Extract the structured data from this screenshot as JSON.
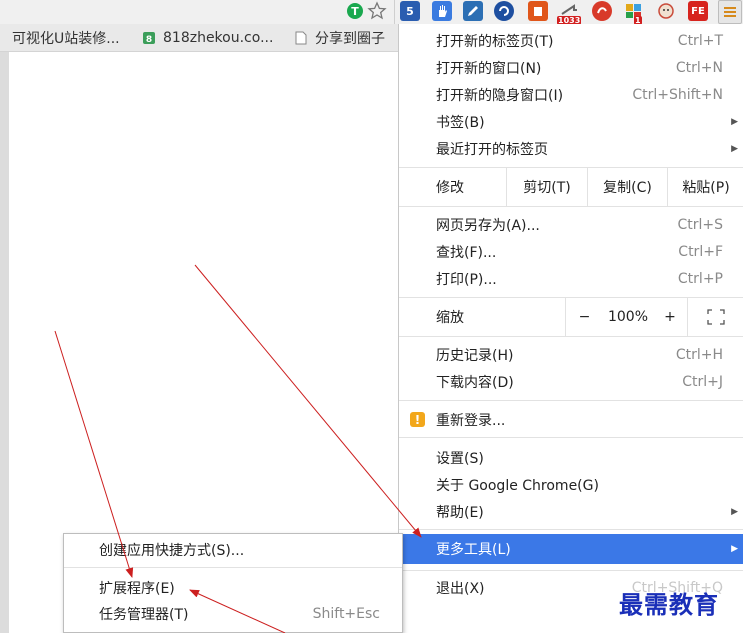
{
  "toolbar": {
    "extensions": [
      {
        "icon": "green-shield-extension-icon",
        "color": "#1aa84f",
        "text": ""
      },
      {
        "icon": "star-bookmark-icon",
        "color": "",
        "text": ""
      },
      {
        "icon": "extension-5-icon",
        "color": "#2a5db0",
        "text": "5"
      },
      {
        "icon": "hand-extension-icon",
        "color": "#3a7be0",
        "text": ""
      },
      {
        "icon": "pen-extension-icon",
        "color": "#2c6fb4",
        "text": ""
      },
      {
        "icon": "swirl-extension-icon",
        "color": "#1e4fa0",
        "text": ""
      },
      {
        "icon": "orange-box-extension-icon",
        "color": "#e0561a",
        "text": ""
      },
      {
        "icon": "arrow-extension-icon",
        "color": "#7a7a7a",
        "text": "",
        "badge": "1033"
      },
      {
        "icon": "red-circle-extension-icon",
        "color": "#d83a2a",
        "text": ""
      },
      {
        "icon": "puzzle-extension-icon",
        "color": "#3aa0e0",
        "text": "",
        "badge": "1"
      },
      {
        "icon": "mascot-extension-icon",
        "color": "#c94b3a",
        "text": ""
      },
      {
        "icon": "fe-extension-icon",
        "color": "#d7241e",
        "text": "FE"
      },
      {
        "icon": "chrome-menu-icon",
        "color": "#e0a340",
        "text": ""
      }
    ]
  },
  "bookmarks": [
    {
      "label": "可视化U站装修..."
    },
    {
      "label": "818zhekou.co..."
    },
    {
      "label": "分享到圈子"
    }
  ],
  "menu": {
    "new_tab": {
      "label": "打开新的标签页(T)",
      "shortcut": "Ctrl+T"
    },
    "new_window": {
      "label": "打开新的窗口(N)",
      "shortcut": "Ctrl+N"
    },
    "incognito": {
      "label": "打开新的隐身窗口(I)",
      "shortcut": "Ctrl+Shift+N"
    },
    "bookmarks": {
      "label": "书签(B)"
    },
    "recent_tabs": {
      "label": "最近打开的标签页"
    },
    "edit": {
      "label": "修改",
      "cut": "剪切(T)",
      "copy": "复制(C)",
      "paste": "粘贴(P)"
    },
    "save_page": {
      "label": "网页另存为(A)...",
      "shortcut": "Ctrl+S"
    },
    "find": {
      "label": "查找(F)...",
      "shortcut": "Ctrl+F"
    },
    "print": {
      "label": "打印(P)...",
      "shortcut": "Ctrl+P"
    },
    "zoom": {
      "label": "缩放",
      "minus": "−",
      "value": "100%",
      "plus": "+"
    },
    "history": {
      "label": "历史记录(H)",
      "shortcut": "Ctrl+H"
    },
    "downloads": {
      "label": "下载内容(D)",
      "shortcut": "Ctrl+J"
    },
    "relogin": {
      "label": "重新登录..."
    },
    "settings": {
      "label": "设置(S)"
    },
    "about": {
      "label": "关于 Google Chrome(G)"
    },
    "help": {
      "label": "帮助(E)"
    },
    "more_tools": {
      "label": "更多工具(L)"
    },
    "exit": {
      "label": "退出(X)",
      "shortcut": "Ctrl+Shift+Q"
    },
    "highlight_color": "#3b78e7"
  },
  "submenu": {
    "create_shortcut": {
      "label": "创建应用快捷方式(S)..."
    },
    "extensions": {
      "label": "扩展程序(E)"
    },
    "task_manager": {
      "label": "任务管理器(T)",
      "shortcut": "Shift+Esc"
    }
  },
  "watermark": {
    "text": "最需教育"
  },
  "annotation_color": "#cc1f1f"
}
